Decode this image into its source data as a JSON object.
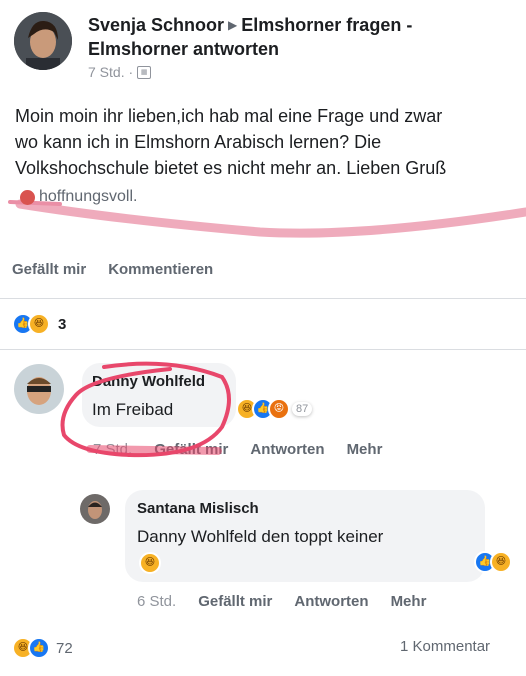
{
  "post": {
    "author": "Svenja Schnoor",
    "group_line1": "Elmshorner fragen -",
    "group_line2": "Elmshorner antworten",
    "time": "7 Std. ·",
    "body_lines": [
      "Moin moin ihr lieben,ich hab mal eine Frage und zwar",
      "wo kann ich in Elmshorn Arabisch lernen? Die",
      "Volkshochschule bietet es nicht mehr an. Lieben Gruß"
    ],
    "feeling": "hoffnungsvoll.",
    "actions": {
      "like": "Gefällt mir",
      "comment": "Kommentieren"
    },
    "reaction_count": "3"
  },
  "comment1": {
    "author": "Danny Wohlfeld",
    "text": "Im Freibad",
    "reaction_count": "87",
    "time": "7 Std.",
    "like": "Gefällt mir",
    "reply": "Antworten",
    "more": "Mehr"
  },
  "reply1": {
    "author": "Santana Mislisch",
    "text": "Danny Wohlfeld den toppt keiner",
    "time": "6 Std.",
    "like": "Gefällt mir",
    "reply": "Antworten",
    "more": "Mehr"
  },
  "footer": {
    "reaction_count": "72",
    "comments": "1 Kommentar"
  },
  "colors": {
    "highlight": "#ea8fa6",
    "like_blue": "#1877f2",
    "haha_yellow": "#f7b125"
  }
}
